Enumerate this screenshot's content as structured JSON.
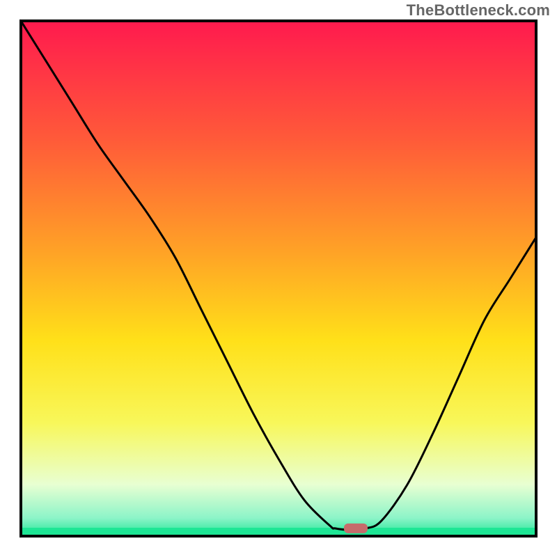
{
  "watermark": {
    "text": "TheBottleneck.com"
  },
  "chart_data": {
    "type": "line",
    "title": "",
    "xlabel": "",
    "ylabel": "",
    "xlim": [
      0,
      100
    ],
    "ylim": [
      0,
      100
    ],
    "grid": false,
    "legend": null,
    "background_gradient": {
      "stops": [
        {
          "offset": 0.0,
          "color": "#ff1a4e"
        },
        {
          "offset": 0.23,
          "color": "#ff5a39"
        },
        {
          "offset": 0.45,
          "color": "#ffa326"
        },
        {
          "offset": 0.62,
          "color": "#ffe019"
        },
        {
          "offset": 0.78,
          "color": "#f8f75a"
        },
        {
          "offset": 0.9,
          "color": "#e8ffd2"
        },
        {
          "offset": 0.965,
          "color": "#8cf4c8"
        },
        {
          "offset": 1.0,
          "color": "#1ee695"
        }
      ]
    },
    "series": [
      {
        "name": "bottleneck-curve",
        "x": [
          0,
          5,
          10,
          15,
          20,
          25,
          30,
          35,
          40,
          45,
          50,
          55,
          60,
          61,
          64,
          67,
          70,
          75,
          80,
          85,
          90,
          95,
          100
        ],
        "y": [
          100,
          92,
          84,
          76,
          69,
          62,
          54,
          44,
          34,
          24,
          15,
          7,
          2,
          1.5,
          1.2,
          1.5,
          3,
          10,
          20,
          31,
          42,
          50,
          58
        ]
      }
    ],
    "marker": {
      "name": "target-marker",
      "x": 65,
      "y": 1.5,
      "color": "#c66b6b",
      "shape": "rounded-bar"
    },
    "frame": {
      "stroke": "#000000",
      "width": 4
    }
  }
}
